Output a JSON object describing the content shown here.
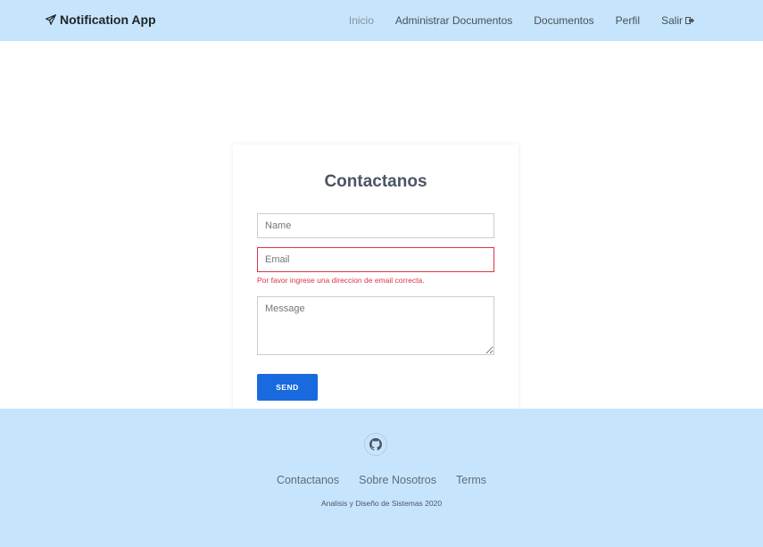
{
  "nav": {
    "brand": "Notification App",
    "brand_icon": "paper-plane-icon",
    "links": [
      {
        "label": "Inicio",
        "active": true
      },
      {
        "label": "Administrar Documentos"
      },
      {
        "label": "Documentos"
      },
      {
        "label": "Perfil"
      },
      {
        "label": "Salir"
      }
    ],
    "logout_icon": "sign-out-icon"
  },
  "form": {
    "title": "Contactanos",
    "name_placeholder": "Name",
    "email_placeholder": "Email",
    "email_error": "Por favor ingrese una direccion de email correcta.",
    "message_placeholder": "Message",
    "send_label": "SEND"
  },
  "footer": {
    "icon": "github-icon",
    "links": [
      "Contactanos",
      "Sobre Nosotros",
      "Terms"
    ],
    "copyright": "Analisis y Diseño de Sistemas 2020"
  },
  "colors": {
    "nav_bg": "#c6e5fd",
    "primary": "#1a6adf",
    "error": "#dc3545"
  }
}
